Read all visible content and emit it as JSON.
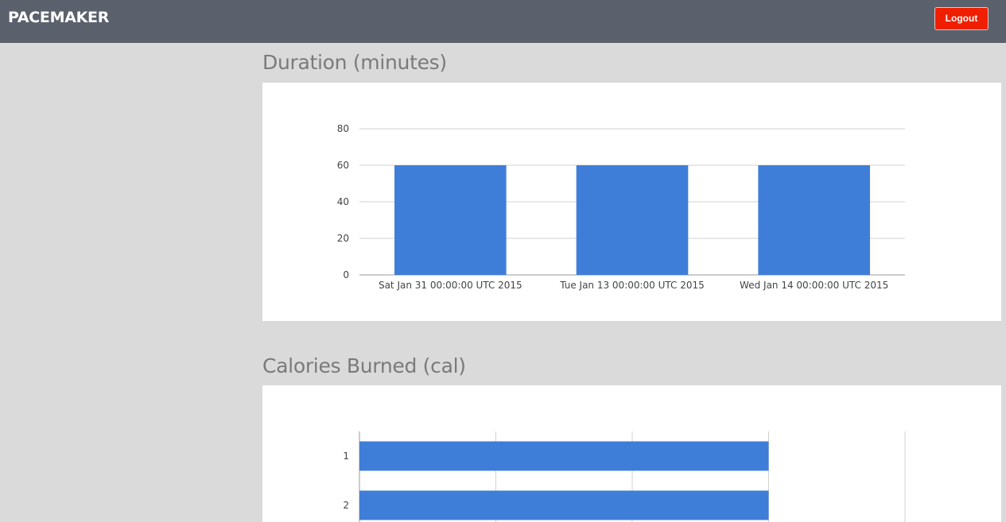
{
  "header": {
    "brand": "PACEMAKER",
    "logout_label": "Logout"
  },
  "colors": {
    "bar": "#3f7ed8",
    "header_bg": "#5a616c",
    "logout_bg": "#ef1f00"
  },
  "sections": {
    "duration": {
      "title": "Duration (minutes)"
    },
    "calories": {
      "title": "Calories Burned (cal)"
    }
  },
  "chart_data": [
    {
      "type": "bar",
      "orientation": "vertical",
      "categories": [
        "Sat Jan 31 00:00:00 UTC 2015",
        "Tue Jan 13 00:00:00 UTC 2015",
        "Wed Jan 14 00:00:00 UTC 2015"
      ],
      "values": [
        60,
        60,
        60
      ],
      "ylim": [
        0,
        80
      ],
      "yticks": [
        0,
        20,
        40,
        60,
        80
      ],
      "grid": true
    },
    {
      "type": "bar",
      "orientation": "horizontal",
      "categories": [
        "1",
        "2"
      ],
      "values": [
        3,
        3
      ],
      "xlim": [
        0,
        4
      ],
      "xticks": [
        0,
        1,
        2,
        3,
        4
      ],
      "grid": true
    }
  ]
}
